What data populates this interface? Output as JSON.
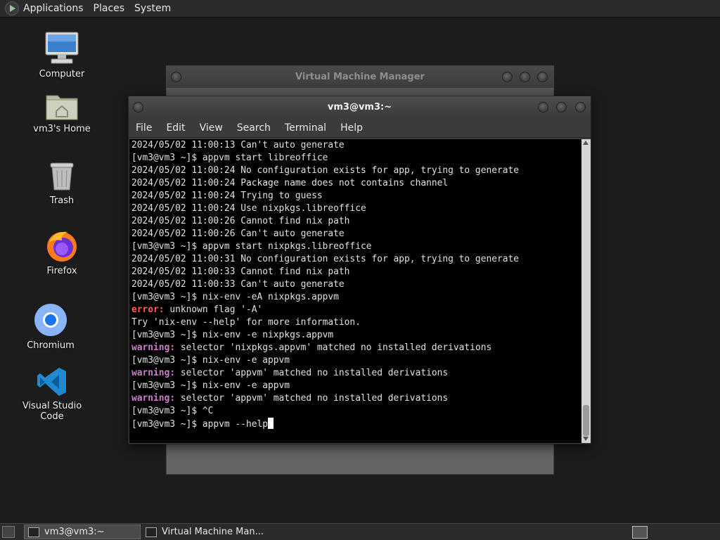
{
  "top_panel": {
    "menus": [
      "Applications",
      "Places",
      "System"
    ]
  },
  "desktop": {
    "icons": [
      {
        "label": "Computer",
        "icon": "computer-icon"
      },
      {
        "label": "vm3's Home",
        "icon": "home-folder-icon"
      },
      {
        "label": "Trash",
        "icon": "trash-icon"
      },
      {
        "label": "Firefox",
        "icon": "firefox-icon"
      },
      {
        "label": "Chromium",
        "icon": "chromium-icon"
      },
      {
        "label": "Visual Studio Code",
        "icon": "vscode-icon"
      }
    ]
  },
  "vmm_window": {
    "title": "Virtual Machine Manager"
  },
  "terminal": {
    "title": "vm3@vm3:~",
    "menu": [
      "File",
      "Edit",
      "View",
      "Search",
      "Terminal",
      "Help"
    ],
    "lines": [
      {
        "text": "2024/05/02 11:00:13 Can't auto generate"
      },
      {
        "text": "[vm3@vm3 ~]$ appvm start libreoffice"
      },
      {
        "text": "2024/05/02 11:00:24 No configuration exists for app, trying to generate"
      },
      {
        "text": "2024/05/02 11:00:24 Package name does not contains channel"
      },
      {
        "text": "2024/05/02 11:00:24 Trying to guess"
      },
      {
        "text": "2024/05/02 11:00:24 Use nixpkgs.libreoffice"
      },
      {
        "text": "2024/05/02 11:00:26 Cannot find nix path"
      },
      {
        "text": "2024/05/02 11:00:26 Can't auto generate"
      },
      {
        "text": "[vm3@vm3 ~]$ appvm start nixpkgs.libreoffice"
      },
      {
        "text": "2024/05/02 11:00:31 No configuration exists for app, trying to generate"
      },
      {
        "text": "2024/05/02 11:00:33 Cannot find nix path"
      },
      {
        "text": "2024/05/02 11:00:33 Can't auto generate"
      },
      {
        "text": "[vm3@vm3 ~]$ nix-env -eA nixpkgs.appvm"
      },
      {
        "prefix": "error:",
        "kind": "err",
        "text": " unknown flag '-A'"
      },
      {
        "text": "Try 'nix-env --help' for more information."
      },
      {
        "text": "[vm3@vm3 ~]$ nix-env -e nixpkgs.appvm"
      },
      {
        "prefix": "warning:",
        "kind": "warn",
        "text": " selector 'nixpkgs.appvm' matched no installed derivations"
      },
      {
        "text": "[vm3@vm3 ~]$ nix-env -e appvm"
      },
      {
        "prefix": "warning:",
        "kind": "warn",
        "text": " selector 'appvm' matched no installed derivations"
      },
      {
        "text": "[vm3@vm3 ~]$ nix-env -e appvm"
      },
      {
        "prefix": "warning:",
        "kind": "warn",
        "text": " selector 'appvm' matched no installed derivations"
      },
      {
        "text": "[vm3@vm3 ~]$ ^C"
      },
      {
        "text": "[vm3@vm3 ~]$ appvm --help",
        "cursor": true
      }
    ]
  },
  "taskbar": {
    "tasks": [
      "vm3@vm3:~",
      "Virtual Machine Man..."
    ]
  },
  "colors": {
    "error": "#ff5a5a",
    "warning": "#c97fc7",
    "terminal_bg": "#000000",
    "desktop_bg": "#1c1c1c"
  }
}
